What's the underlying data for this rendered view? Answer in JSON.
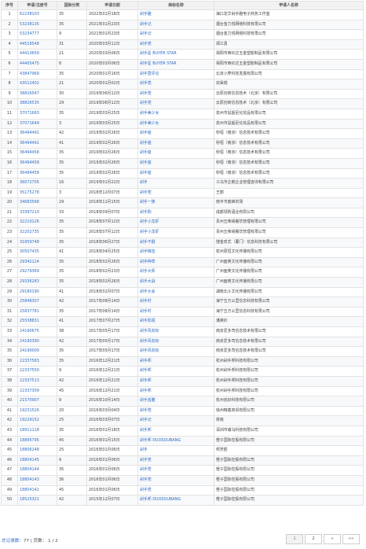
{
  "columns": {
    "no": "序号",
    "reg": "申请/注册号",
    "cls": "国际分类",
    "date": "申请日期",
    "name": "商标名称",
    "applicant": "申请人名称"
  },
  "rows": [
    {
      "no": "1",
      "reg": "62238103",
      "cls": "35",
      "date": "2022年01月18日",
      "name": "剁手趣",
      "applicant": "海口龙华剁手趣电子商务工作室"
    },
    {
      "no": "2",
      "reg": "53238135",
      "cls": "35",
      "date": "2021年01月23日",
      "name": "剁手记",
      "applicant": "烟台金力悦网络科技有限公司"
    },
    {
      "no": "3",
      "reg": "53234777",
      "cls": "9",
      "date": "2021年01月23日",
      "name": "剁手记",
      "applicant": "烟台金力悦网络科技有限公司"
    },
    {
      "no": "4",
      "reg": "44518548",
      "cls": "31",
      "date": "2020年03月11日",
      "name": "剁手党",
      "applicant": "郑江勇"
    },
    {
      "no": "5",
      "reg": "44413659",
      "cls": "21",
      "date": "2020年03月06日",
      "name": "剁手星 BUYER STAR",
      "applicant": "揭阳市西红达五金塑胶制品有限公司"
    },
    {
      "no": "6",
      "reg": "44405475",
      "cls": "8",
      "date": "2020年03月06日",
      "name": "剁手星 BUYER STAR",
      "applicant": "揭阳市西红达五金塑胶制品有限公司"
    },
    {
      "no": "7",
      "reg": "43847969",
      "cls": "35",
      "date": "2020年01月16日",
      "name": "剁手君评论",
      "applicant": "北京小萝科技发展有限公司"
    },
    {
      "no": "8",
      "reg": "43512402",
      "cls": "21",
      "date": "2020年01月02日",
      "name": "剁手党",
      "applicant": "宗昊锐"
    },
    {
      "no": "9",
      "reg": "38826547",
      "cls": "30",
      "date": "2019年06月12日",
      "name": "剁手党",
      "applicant": "云原创商信息技术（北京）有限公司"
    },
    {
      "no": "10",
      "reg": "38826535",
      "cls": "29",
      "date": "2019年06月12日",
      "name": "剁手党",
      "applicant": "云原创商信息技术（北京）有限公司"
    },
    {
      "no": "11",
      "reg": "37071663",
      "cls": "35",
      "date": "2019年03月25日",
      "name": "剁手美少女",
      "applicant": "泉州市鼠超尼化妆品有限公司"
    },
    {
      "no": "12",
      "reg": "37071649",
      "cls": "3",
      "date": "2019年03月25日",
      "name": "剁手美少女",
      "applicant": "泉州市鼠超尼化妆品有限公司"
    },
    {
      "no": "13",
      "reg": "36494491",
      "cls": "42",
      "date": "2019年02月26日",
      "name": "剁手爸",
      "applicant": "秒桓（南京）信息技术有限公司"
    },
    {
      "no": "14",
      "reg": "36494491",
      "cls": "41",
      "date": "2019年02月26日",
      "name": "剁手爸",
      "applicant": "秒桓（南京）信息技术有限公司"
    },
    {
      "no": "15",
      "reg": "36494458",
      "cls": "35",
      "date": "2019年02月26日",
      "name": "剁手爸",
      "applicant": "秒桓（南京）信息技术有限公司"
    },
    {
      "no": "16",
      "reg": "36494458",
      "cls": "35",
      "date": "2019年02月26日",
      "name": "剁手爸",
      "applicant": "秒桓（南京）信息技术有限公司"
    },
    {
      "no": "17",
      "reg": "36494458",
      "cls": "35",
      "date": "2019年02月26日",
      "name": "剁手爸",
      "applicant": "秒桓（南京）信息技术有限公司"
    },
    {
      "no": "18",
      "reg": "36072705",
      "cls": "16",
      "date": "2019年01月22日",
      "name": "剁手",
      "applicant": "义乌市企鹅企业管理咨询有限公司"
    },
    {
      "no": "19",
      "reg": "35175278",
      "cls": "3",
      "date": "2018年12月07日",
      "name": "剁手党",
      "applicant": "王丽"
    },
    {
      "no": "20",
      "reg": "34683568",
      "cls": "29",
      "date": "2018年11月15日",
      "name": "剁手一族",
      "applicant": "南平市鹿峰农场"
    },
    {
      "no": "21",
      "reg": "33397210",
      "cls": "33",
      "date": "2018年09月07日",
      "name": "剁手购",
      "applicant": "成都领购酒业有限公司"
    },
    {
      "no": "22",
      "reg": "32210126",
      "cls": "35",
      "date": "2018年07月12日",
      "name": "剁手小龙虾",
      "applicant": "贵州五味缘餐饮管理有限公司"
    },
    {
      "no": "23",
      "reg": "32202735",
      "cls": "35",
      "date": "2018年07月12日",
      "name": "剁手小龙虾",
      "applicant": "贵州五味缘餐饮管理有限公司"
    },
    {
      "no": "24",
      "reg": "31859748",
      "cls": "35",
      "date": "2018年06月27日",
      "name": "剁手不戳",
      "applicant": "搜金贰式（厦门）信息科技有限公司"
    },
    {
      "no": "25",
      "reg": "30507435",
      "cls": "41",
      "date": "2018年04月25日",
      "name": "剁手精选",
      "applicant": "杭州原恒文化传播有限公司"
    },
    {
      "no": "26",
      "reg": "29342124",
      "cls": "35",
      "date": "2018年02月26日",
      "name": "剁手种草",
      "applicant": "广州面英文化传播有限公司"
    },
    {
      "no": "27",
      "reg": "29279369",
      "cls": "35",
      "date": "2018年02月23日",
      "name": "剁手大师",
      "applicant": "广州面英文化传播有限公司"
    },
    {
      "no": "28",
      "reg": "29336283",
      "cls": "35",
      "date": "2018年02月26日",
      "name": "剁手大战",
      "applicant": "广州面英文化传播有限公司"
    },
    {
      "no": "29",
      "reg": "29180190",
      "cls": "41",
      "date": "2018年02月07日",
      "name": "剁手大会",
      "applicant": "湖南北斗文化传播有限公司"
    },
    {
      "no": "30",
      "reg": "25848307",
      "cls": "42",
      "date": "2017年08月14日",
      "name": "剁手村",
      "applicant": "海宁五万公里信息科技有限公司"
    },
    {
      "no": "31",
      "reg": "25837781",
      "cls": "35",
      "date": "2017年08月14日",
      "name": "剁手村",
      "applicant": "海宁五万公里信息科技有限公司"
    },
    {
      "no": "32",
      "reg": "25538831",
      "cls": "41",
      "date": "2017年07月27日",
      "name": "剁手影视",
      "applicant": "潘爽红"
    },
    {
      "no": "33",
      "reg": "24190675",
      "cls": "38",
      "date": "2017年05月17日",
      "name": "剁手风向标",
      "applicant": "南京爱多司信息技术有限公司"
    },
    {
      "no": "34",
      "reg": "24190390",
      "cls": "42",
      "date": "2017年05月17日",
      "name": "剁手风向标",
      "applicant": "南京爱多司信息技术有限公司"
    },
    {
      "no": "35",
      "reg": "24190009",
      "cls": "35",
      "date": "2017年05月17日",
      "name": "剁手风向标",
      "applicant": "南京爱多司信息技术有限公司"
    },
    {
      "no": "36",
      "reg": "22337583",
      "cls": "35",
      "date": "2016年12月21日",
      "name": "剁手邦",
      "applicant": "杭州剁手邦科技有限公司"
    },
    {
      "no": "37",
      "reg": "22337550",
      "cls": "9",
      "date": "2016年12月21日",
      "name": "剁手邦",
      "applicant": "杭州剁手邦科技有限公司"
    },
    {
      "no": "38",
      "reg": "22337513",
      "cls": "42",
      "date": "2016年12月21日",
      "name": "剁手邦",
      "applicant": "杭州剁手邦科技有限公司"
    },
    {
      "no": "39",
      "reg": "22337309",
      "cls": "45",
      "date": "2016年12月21日",
      "name": "剁手邦",
      "applicant": "杭州剁手邦科技有限公司"
    },
    {
      "no": "40",
      "reg": "21570907",
      "cls": "9",
      "date": "2016年10月14日",
      "name": "剁手酋雕",
      "applicant": "杭州完好科技有限公司"
    },
    {
      "no": "41",
      "reg": "19231526",
      "cls": "20",
      "date": "2016年03月04日",
      "name": "剁手党",
      "applicant": "徐州精鑫商贸有限公司"
    },
    {
      "no": "42",
      "reg": "19229152",
      "cls": "25",
      "date": "2016年03月07日",
      "name": "剁手记",
      "applicant": "侯南"
    },
    {
      "no": "43",
      "reg": "18911118",
      "cls": "35",
      "date": "2016年01月18日",
      "name": "剁手邦",
      "applicant": "深圳市甫乌科技有限公司"
    },
    {
      "no": "44",
      "reg": "18895795",
      "cls": "45",
      "date": "2016年01月15日",
      "name": "剁手邦 DUOSOUBANG",
      "applicant": "橙子国际控股有限公司"
    },
    {
      "no": "45",
      "reg": "18806248",
      "cls": "25",
      "date": "2016年01月06日",
      "name": "剁手",
      "applicant": "邦芳胜"
    },
    {
      "no": "46",
      "reg": "18804145",
      "cls": "9",
      "date": "2016年01月06日",
      "name": "剁手党",
      "applicant": "橙子国际控股有限公司"
    },
    {
      "no": "47",
      "reg": "18804144",
      "cls": "35",
      "date": "2016年01月06日",
      "name": "剁手党",
      "applicant": "橙子国际控股有限公司"
    },
    {
      "no": "48",
      "reg": "18804143",
      "cls": "36",
      "date": "2016年01月06日",
      "name": "剁手党",
      "applicant": "橙子国际控股有限公司"
    },
    {
      "no": "49",
      "reg": "18804142",
      "cls": "45",
      "date": "2016年01月06日",
      "name": "剁手党",
      "applicant": "橙子国际控股有限公司"
    },
    {
      "no": "50",
      "reg": "18525321",
      "cls": "42",
      "date": "2015年12月07日",
      "name": "剁手邦 DUOSOUBANG",
      "applicant": "橙子国际控股有限公司"
    }
  ],
  "footer": {
    "total_label": "总记录数：",
    "total": "77",
    "pages_label": "| 页数：",
    "pages": "1 / 2"
  },
  "pager": [
    "1",
    "2",
    "»",
    "»»"
  ]
}
